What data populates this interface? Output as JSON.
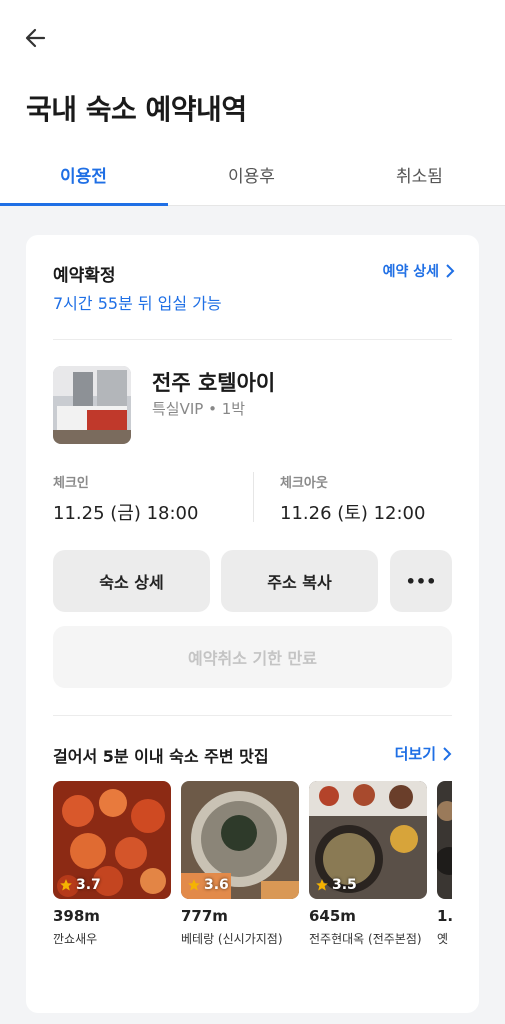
{
  "header": {
    "title": "국내 숙소 예약내역"
  },
  "tabs": [
    {
      "label": "이용전",
      "active": true
    },
    {
      "label": "이용후",
      "active": false
    },
    {
      "label": "취소됨",
      "active": false
    }
  ],
  "booking": {
    "status": "예약확정",
    "entry_info": "7시간 55분 뒤 입실 가능",
    "detail_link": "예약 상세",
    "hotel_name": "전주 호텔아이",
    "room_info": "특실VIP • 1박",
    "checkin_label": "체크인",
    "checkin_time": "11.25 (금) 18:00",
    "checkout_label": "체크아웃",
    "checkout_time": "11.26 (토) 12:00",
    "buttons": {
      "hotel_detail": "숙소 상세",
      "copy_address": "주소 복사",
      "more": "•••"
    },
    "cancel_notice": "예약취소 기한 만료"
  },
  "nearby": {
    "title": "걸어서 5분 이내 숙소 주변 맛집",
    "more_link": "더보기",
    "places": [
      {
        "rating": "3.7",
        "distance": "398m",
        "name": "깐쇼새우"
      },
      {
        "rating": "3.6",
        "distance": "777m",
        "name": "베테랑 (신시가지점)"
      },
      {
        "rating": "3.5",
        "distance": "645m",
        "name": "전주현대옥 (전주본점)"
      },
      {
        "rating": "",
        "distance": "1.",
        "name": "옛"
      }
    ]
  },
  "colors": {
    "accent": "#1f6fe5",
    "star": "#f5b301"
  }
}
